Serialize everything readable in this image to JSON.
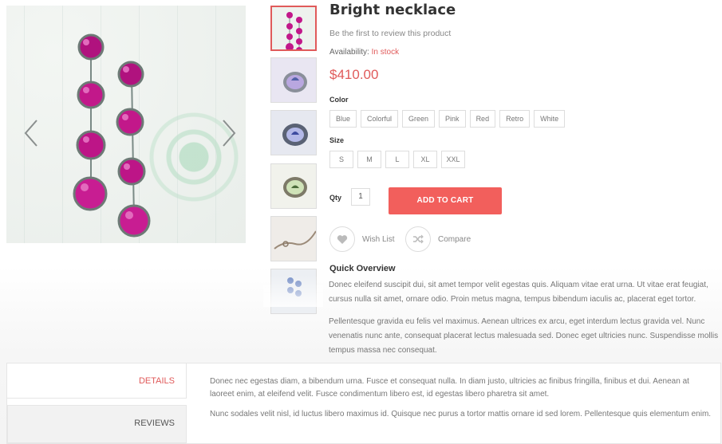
{
  "product": {
    "title": "Bright necklace",
    "review_link": "Be the first to review this product",
    "availability_label": "Availability:",
    "availability_value": "In stock",
    "price": "$410.00"
  },
  "options": {
    "color_label": "Color",
    "colors": [
      "Blue",
      "Colorful",
      "Green",
      "Pink",
      "Red",
      "Retro",
      "White"
    ],
    "size_label": "Size",
    "sizes": [
      "S",
      "M",
      "L",
      "XL",
      "XXL"
    ]
  },
  "cart": {
    "qty_label": "Qty",
    "qty_value": "1",
    "add_to_cart": "ADD TO CART"
  },
  "actions": {
    "wishlist": "Wish List",
    "compare": "Compare"
  },
  "overview": {
    "title": "Quick Overview",
    "paragraphs": [
      "Donec eleifend suscipit dui, sit amet tempor velit egestas quis. Aliquam vitae erat urna. Ut vitae erat feugiat, cursus nulla sit amet, ornare odio. Proin metus magna, tempus bibendum iaculis ac, placerat eget tortor.",
      "Pellentesque gravida eu felis vel maximus. Aenean ultrices ex arcu, eget interdum lectus gravida vel. Nunc venenatis nunc ante, consequat placerat lectus malesuada sed. Donec eget ultricies nunc. Suspendisse mollis tempus massa nec consequat."
    ]
  },
  "tabs": {
    "details": "DETAILS",
    "reviews": "REVIEWS",
    "details_paragraphs": [
      "Donec nec egestas diam, a bibendum urna. Fusce et consequat nulla. In diam justo, ultricies ac finibus fringilla, finibus et dui. Aenean at laoreet enim, at eleifend velit. Fusce condimentum libero est, id egestas libero pharetra sit amet.",
      "Nunc sodales velit nisl, id luctus libero maximus id. Quisque nec purus a tortor mattis ornare id sed lorem. Pellentesque quis elementum enim."
    ]
  },
  "colors": {
    "accent": "#e05a5a",
    "cart_button": "#f25f5c",
    "bead": "#c2188a"
  },
  "icons": {
    "prev": "chevron-left-icon",
    "next": "chevron-right-icon",
    "wishlist": "heart-icon",
    "compare": "shuffle-icon"
  }
}
